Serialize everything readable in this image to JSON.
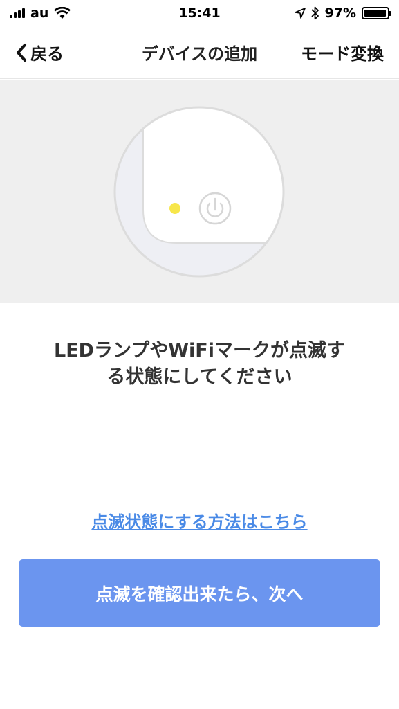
{
  "status_bar": {
    "carrier": "au",
    "time": "15:41",
    "battery_percent": "97%",
    "battery_level": 0.97,
    "icons": [
      "signal-icon",
      "wifi-icon",
      "location-arrow-icon",
      "bluetooth-icon",
      "battery-icon"
    ]
  },
  "nav": {
    "back_label": "戻る",
    "title": "デバイスの追加",
    "mode_label": "モード変換"
  },
  "illustration": {
    "led_color": "#f7e64a",
    "icons": [
      "device-corner-illustration",
      "led-indicator",
      "power-icon"
    ]
  },
  "instruction": {
    "line1": "LEDランプやWiFiマークが点滅す",
    "line2": "る状態にしてください"
  },
  "help_link": "点滅状態にする方法はこちら",
  "next_button": "点滅を確認出来たら、次へ",
  "colors": {
    "accent": "#6b95ef",
    "link": "#4a8ae6",
    "illustration_bg": "#efefef"
  }
}
